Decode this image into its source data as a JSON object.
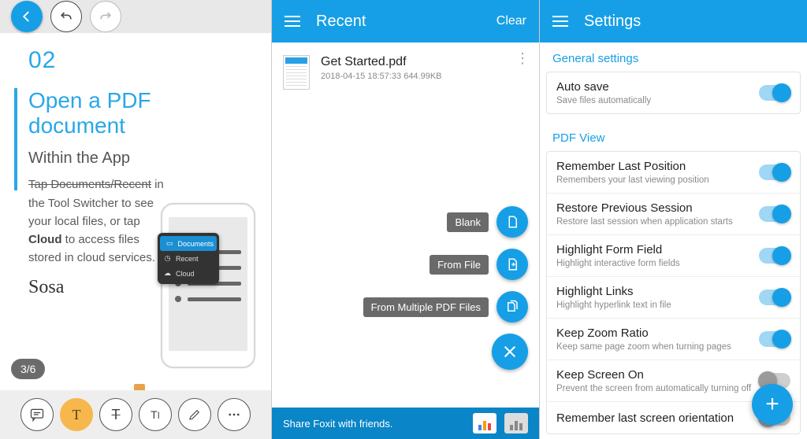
{
  "colors": {
    "accent": "#169fe6"
  },
  "left": {
    "page_num": "02",
    "title_line1": "Open a PDF",
    "title_line2": "document",
    "subtitle": "Within the App",
    "para_strike": "Tap Documents/Recent",
    "para_rest1": "in  the Tool Switcher to see your local files, or tap ",
    "para_bold": "Cloud",
    "para_rest2": " to access files stored in cloud services.",
    "signature": "Sosa",
    "page_badge": "3/6",
    "switcher": {
      "documents": "Documents",
      "recent": "Recent",
      "cloud": "Cloud"
    }
  },
  "mid": {
    "title": "Recent",
    "clear": "Clear",
    "file": {
      "name": "Get Started.pdf",
      "meta": "2018-04-15 18:57:33  644.99KB"
    },
    "fab": {
      "blank": "Blank",
      "from_file": "From File",
      "from_multi": "From Multiple PDF Files"
    },
    "share": "Share Foxit with friends."
  },
  "right": {
    "title": "Settings",
    "section_general": "General settings",
    "section_pdfview": "PDF View",
    "items": {
      "autosave": {
        "title": "Auto save",
        "sub": "Save files automatically"
      },
      "lastpos": {
        "title": "Remember Last Position",
        "sub": "Remembers your last viewing position"
      },
      "restore": {
        "title": "Restore Previous Session",
        "sub": "Restore last session when application starts"
      },
      "formfield": {
        "title": "Highlight Form Field",
        "sub": "Highlight interactive form fields"
      },
      "links": {
        "title": "Highlight Links",
        "sub": "Highlight hyperlink text in file"
      },
      "zoom": {
        "title": "Keep Zoom Ratio",
        "sub": "Keep same page zoom when turning pages"
      },
      "screenon": {
        "title": "Keep Screen On",
        "sub": "Prevent the screen from automatically turning off"
      },
      "orient": {
        "title": "Remember last screen orientation",
        "sub": ""
      }
    }
  }
}
